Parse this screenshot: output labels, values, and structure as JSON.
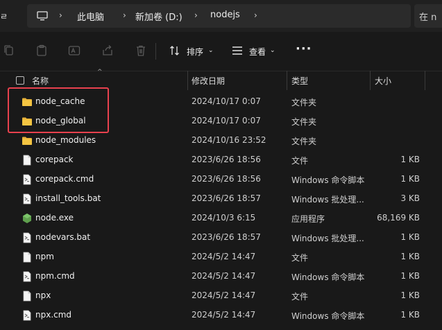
{
  "address": {
    "left_fragment": "ㄹ",
    "crumbs": [
      "此电脑",
      "新加卷 (D:)",
      "nodejs"
    ],
    "search_placeholder": "在 n"
  },
  "toolbar": {
    "sort_label": "排序",
    "view_label": "查看"
  },
  "columns": {
    "name": "名称",
    "date": "修改日期",
    "type": "类型",
    "size": "大小"
  },
  "files": [
    {
      "name": "node_cache",
      "date": "2024/10/17 0:07",
      "type": "文件夹",
      "size": "",
      "icon": "folder-icon"
    },
    {
      "name": "node_global",
      "date": "2024/10/17 0:07",
      "type": "文件夹",
      "size": "",
      "icon": "folder-icon"
    },
    {
      "name": "node_modules",
      "date": "2024/10/16 23:52",
      "type": "文件夹",
      "size": "",
      "icon": "folder-icon"
    },
    {
      "name": "corepack",
      "date": "2023/6/26 18:56",
      "type": "文件",
      "size": "1 KB",
      "icon": "file-icon"
    },
    {
      "name": "corepack.cmd",
      "date": "2023/6/26 18:56",
      "type": "Windows 命令脚本",
      "size": "1 KB",
      "icon": "script-file-icon"
    },
    {
      "name": "install_tools.bat",
      "date": "2023/6/26 18:57",
      "type": "Windows 批处理...",
      "size": "3 KB",
      "icon": "script-file-icon"
    },
    {
      "name": "node.exe",
      "date": "2024/10/3 6:15",
      "type": "应用程序",
      "size": "68,169 KB",
      "icon": "nodejs-icon"
    },
    {
      "name": "nodevars.bat",
      "date": "2023/6/26 18:57",
      "type": "Windows 批处理...",
      "size": "1 KB",
      "icon": "script-file-icon"
    },
    {
      "name": "npm",
      "date": "2024/5/2 14:47",
      "type": "文件",
      "size": "1 KB",
      "icon": "file-icon"
    },
    {
      "name": "npm.cmd",
      "date": "2024/5/2 14:47",
      "type": "Windows 命令脚本",
      "size": "1 KB",
      "icon": "script-file-icon"
    },
    {
      "name": "npx",
      "date": "2024/5/2 14:47",
      "type": "文件",
      "size": "1 KB",
      "icon": "file-icon"
    },
    {
      "name": "npx.cmd",
      "date": "2024/5/2 14:47",
      "type": "Windows 命令脚本",
      "size": "1 KB",
      "icon": "script-file-icon"
    }
  ],
  "colors": {
    "background": "#191919",
    "folder": "#f5c542",
    "highlight_border": "#e8414e",
    "node_green": "#5fa04e"
  }
}
